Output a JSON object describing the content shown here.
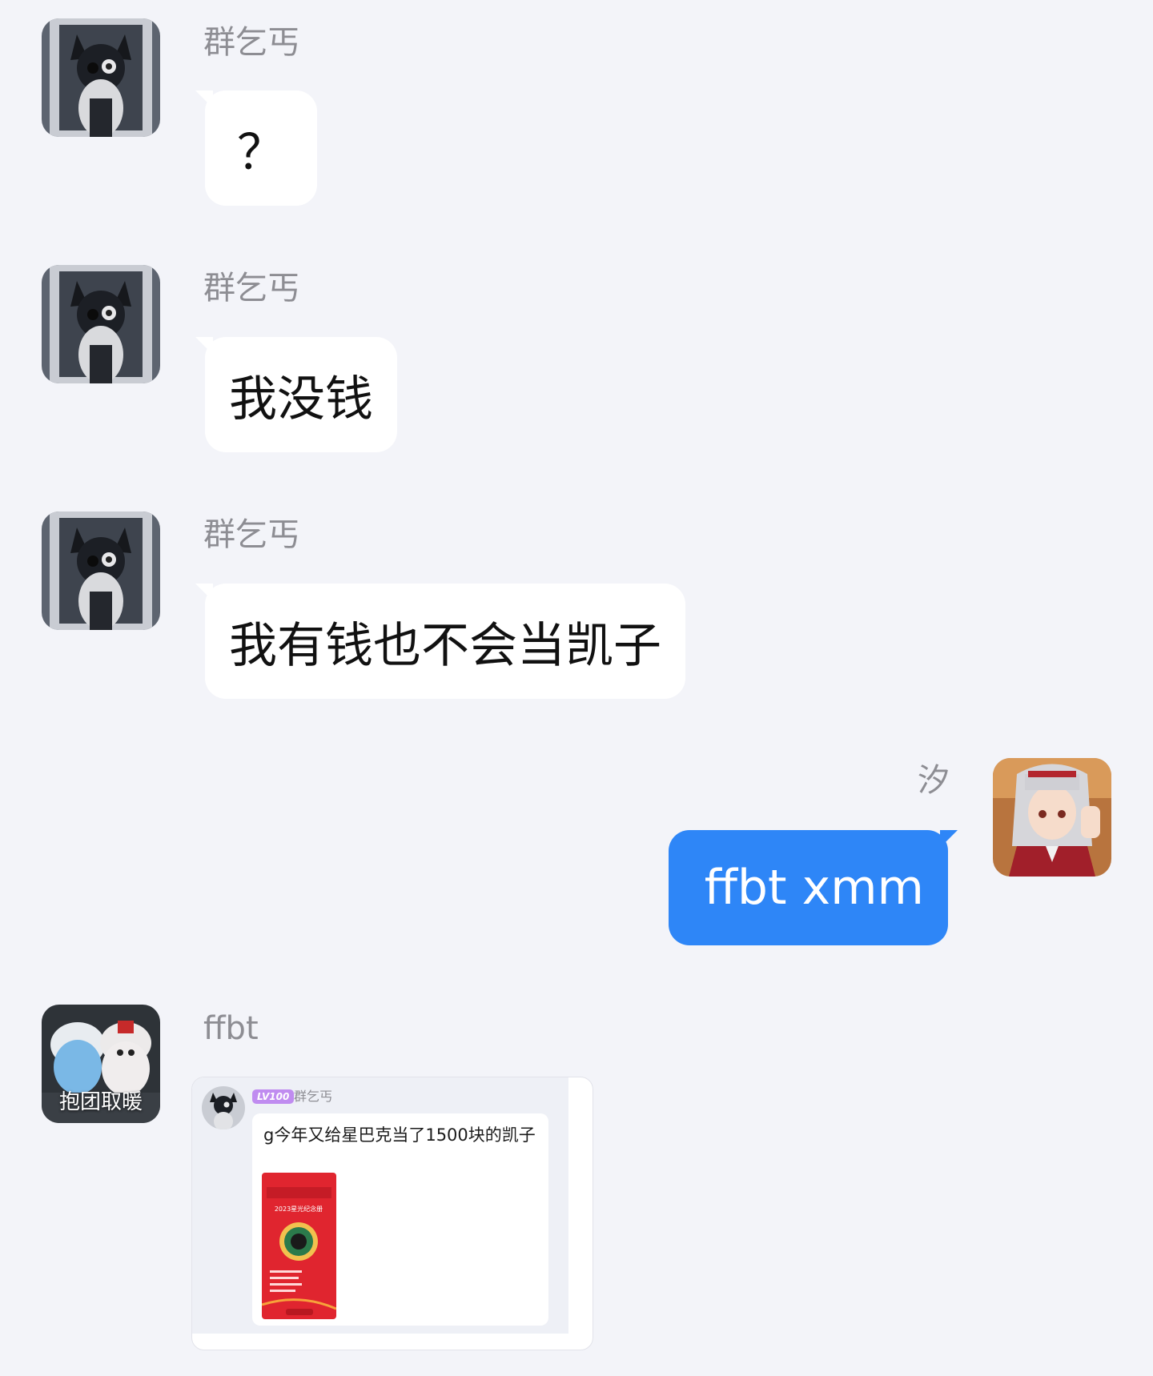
{
  "messages": [
    {
      "sender": "群乞丐",
      "text": "？"
    },
    {
      "sender": "群乞丐",
      "text": "我没钱"
    },
    {
      "sender": "群乞丐",
      "text": "我有钱也不会当凯子"
    },
    {
      "sender": "汐",
      "text": "ffbt xmm"
    }
  ],
  "forward": {
    "sender": "ffbt",
    "avatar_caption": "抱团取暖",
    "level_badge": "LV100",
    "original_sender": "群乞丐",
    "text": "g今年又给星巴克当了1500块的凯子",
    "thumbnail_title": "2023星光纪念册"
  },
  "colors": {
    "background": "#f3f4f9",
    "outgoing_bubble": "#2e86f7",
    "incoming_bubble": "#ffffff",
    "sender_name": "#8d8d93",
    "level_badge": "#c08cf0"
  },
  "icons": {
    "avatar_group_beggar": "cat-eared-anime-avatar-icon",
    "avatar_xi": "anime-girl-avatar-icon",
    "avatar_ffbt": "plush-dolls-avatar-icon"
  }
}
